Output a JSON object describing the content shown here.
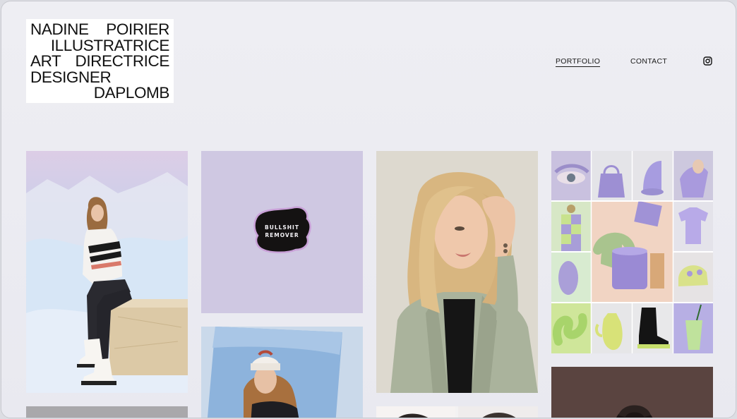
{
  "logo": {
    "lines": [
      [
        "NADINE",
        "POIRIER"
      ],
      [
        "ILLUSTRATRICE"
      ],
      [
        "ART",
        "DIRECTRICE"
      ],
      [
        "DESIGNER"
      ],
      [
        "DAPLOMB"
      ]
    ]
  },
  "nav": {
    "portfolio": "PORTFOLIO",
    "contact": "CONTACT",
    "instagram_icon": "instagram-icon"
  },
  "sticker": {
    "line1": "BULLSHIT",
    "line2": "REMOVER"
  },
  "colors": {
    "lavender": "#cfc8e2",
    "sticker_black": "#141212",
    "sticker_outline": "#c9a0d8"
  }
}
